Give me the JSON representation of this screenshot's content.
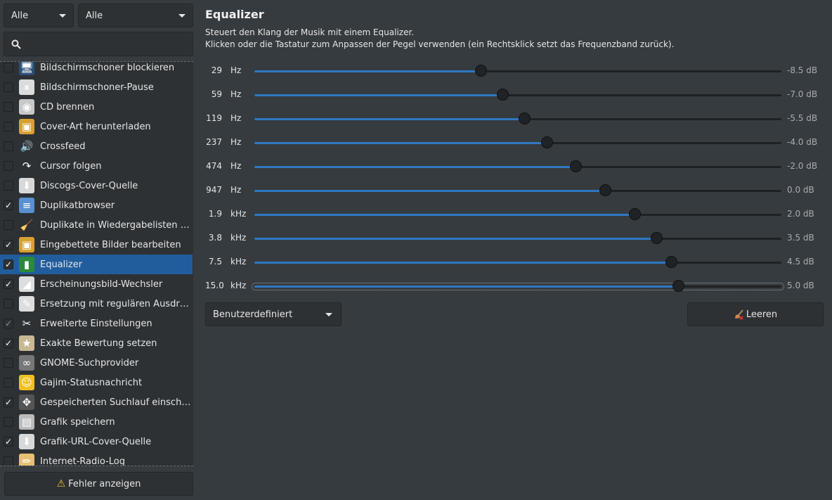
{
  "filters": {
    "first": "Alle",
    "second": "Alle"
  },
  "search": {
    "value": ""
  },
  "plugins": [
    {
      "label": "Bildschirmschoner blockieren",
      "checked": false,
      "icon": "monitor-icon"
    },
    {
      "label": "Bildschirmschoner-Pause",
      "checked": false,
      "icon": "pause-icon"
    },
    {
      "label": "CD brennen",
      "checked": false,
      "icon": "cd-icon"
    },
    {
      "label": "Cover-Art herunterladen",
      "checked": false,
      "icon": "cover-download-icon"
    },
    {
      "label": "Crossfeed",
      "checked": false,
      "icon": "speaker-icon"
    },
    {
      "label": "Cursor folgen",
      "checked": false,
      "icon": "cursor-icon"
    },
    {
      "label": "Discogs-Cover-Quelle",
      "checked": false,
      "icon": "download-icon"
    },
    {
      "label": "Duplikatbrowser",
      "checked": true,
      "icon": "document-icon"
    },
    {
      "label": "Duplikate in Wiedergabelisten entf…",
      "checked": false,
      "icon": "broom-icon"
    },
    {
      "label": "Eingebettete Bilder bearbeiten",
      "checked": true,
      "icon": "image-edit-icon"
    },
    {
      "label": "Equalizer",
      "checked": true,
      "icon": "equalizer-icon",
      "selected": true
    },
    {
      "label": "Erscheinungsbild-Wechsler",
      "checked": true,
      "icon": "theme-icon"
    },
    {
      "label": "Ersetzung mit regulären Ausdrücken",
      "checked": false,
      "icon": "regex-icon"
    },
    {
      "label": "Erweiterte Einstellungen",
      "checked": true,
      "icon": "tools-icon",
      "dim": true
    },
    {
      "label": "Exakte Bewertung setzen",
      "checked": true,
      "icon": "folder-star-icon"
    },
    {
      "label": "GNOME-Suchprovider",
      "checked": false,
      "icon": "binoculars-icon"
    },
    {
      "label": "Gajim-Statusnachricht",
      "checked": false,
      "icon": "smiley-icon"
    },
    {
      "label": "Gespeicherten Suchlauf einschließ…",
      "checked": true,
      "icon": "gamepad-icon"
    },
    {
      "label": "Grafik speichern",
      "checked": false,
      "icon": "floppy-icon"
    },
    {
      "label": "Grafik-URL-Cover-Quelle",
      "checked": true,
      "icon": "download-icon"
    },
    {
      "label": "Internet-Radio-Log",
      "checked": false,
      "icon": "pencil-icon"
    }
  ],
  "error_button": {
    "label": "Fehler anzeigen"
  },
  "equalizer": {
    "title": "Equalizer",
    "description_line1": "Steuert den Klang der Musik mit einem Equalizer.",
    "description_line2": "Klicken oder die Tastatur zum Anpassen der Pegel verwenden (ein Rechtsklick setzt das Frequenzband zurück).",
    "db_range": [
      -24,
      12
    ],
    "bands": [
      {
        "freq": "29",
        "unit": "Hz",
        "db": -8.5,
        "db_label": "-8.5 dB"
      },
      {
        "freq": "59",
        "unit": "Hz",
        "db": -7.0,
        "db_label": "-7.0 dB"
      },
      {
        "freq": "119",
        "unit": "Hz",
        "db": -5.5,
        "db_label": "-5.5 dB"
      },
      {
        "freq": "237",
        "unit": "Hz",
        "db": -4.0,
        "db_label": "-4.0 dB"
      },
      {
        "freq": "474",
        "unit": "Hz",
        "db": -2.0,
        "db_label": "-2.0 dB"
      },
      {
        "freq": "947",
        "unit": "Hz",
        "db": 0.0,
        "db_label": "0.0 dB"
      },
      {
        "freq": "1.9",
        "unit": "kHz",
        "db": 2.0,
        "db_label": "2.0 dB"
      },
      {
        "freq": "3.8",
        "unit": "kHz",
        "db": 3.5,
        "db_label": "3.5 dB"
      },
      {
        "freq": "7.5",
        "unit": "kHz",
        "db": 4.5,
        "db_label": "4.5 dB"
      },
      {
        "freq": "15.0",
        "unit": "kHz",
        "db": 5.0,
        "db_label": "5.0 dB",
        "focused": true
      }
    ],
    "preset": "Benutzerdefiniert",
    "clear_label": "Leeren"
  },
  "colors": {
    "accent": "#215d9c",
    "slider_fill": "#2e78c2",
    "background": "#363b3f"
  }
}
